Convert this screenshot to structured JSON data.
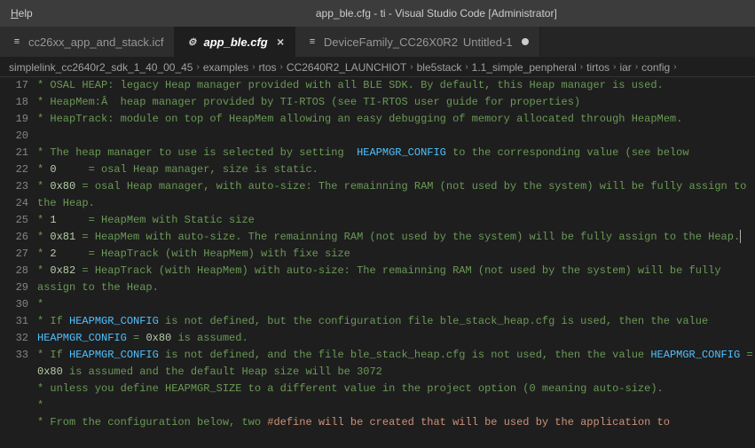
{
  "menu": {
    "help": "Help"
  },
  "window_title": "app_ble.cfg - ti - Visual Studio Code [Administrator]",
  "tabs": [
    {
      "label": "cc26xx_app_and_stack.icf",
      "active": false,
      "dirty": false
    },
    {
      "label": "app_ble.cfg",
      "active": true,
      "dirty": false,
      "close": "×"
    },
    {
      "label": "DeviceFamily_CC26X0R2",
      "suffix": "Untitled-1",
      "active": false,
      "dirty": true
    }
  ],
  "breadcrumb": [
    "simplelink_cc2640r2_sdk_1_40_00_45",
    "examples",
    "rtos",
    "CC2640R2_LAUNCHIOT",
    "ble5stack",
    "1.1_simple_penpheral",
    "tirtos",
    "iar",
    "config"
  ],
  "editor": {
    "startline": 17,
    "lines": [
      "* OSAL HEAP: legacy Heap manager provided with all BLE SDK. By default, this Heap manager is used.",
      "* HeapMem:Â  heap manager provided by TI-RTOS (see TI-RTOS user guide for properties)",
      "* HeapTrack: module on top of HeapMem allowing an easy debugging of memory allocated through HeapMem.",
      "",
      "* The heap manager to use is selected by setting  HEAPMGR_CONFIG to the corresponding value (see below",
      "* 0     = osal Heap manager, size is static.",
      "* 0x80 = osal Heap manager, with auto-size: The remainning RAM (not used by the system) will be fully assign to the Heap.",
      "* 1     = HeapMem with Static size",
      "* 0x81 = HeapMem with auto-size. The remainning RAM (not used by the system) will be fully assign to the Heap.|",
      "* 2     = HeapTrack (with HeapMem) with fixe size",
      "* 0x82 = HeapTrack (with HeapMem) with auto-size: The remainning RAM (not used by the system) will be fully assign to the Heap.",
      "*",
      "* If HEAPMGR_CONFIG is not defined, but the configuration file ble_stack_heap.cfg is used, then the value HEAPMGR_CONFIG = 0x80 is assumed.",
      "* If HEAPMGR_CONFIG is not defined, and the file ble_stack_heap.cfg is not used, then the value HEAPMGR_CONFIG = 0x80 is assumed and the default Heap size will be 3072",
      "* unless you define HEAPMGR_SIZE to a different value in the project option (0 meaning auto-size).",
      "*",
      "* From the configuration below, two #define will be created that will be used by the application to"
    ]
  }
}
